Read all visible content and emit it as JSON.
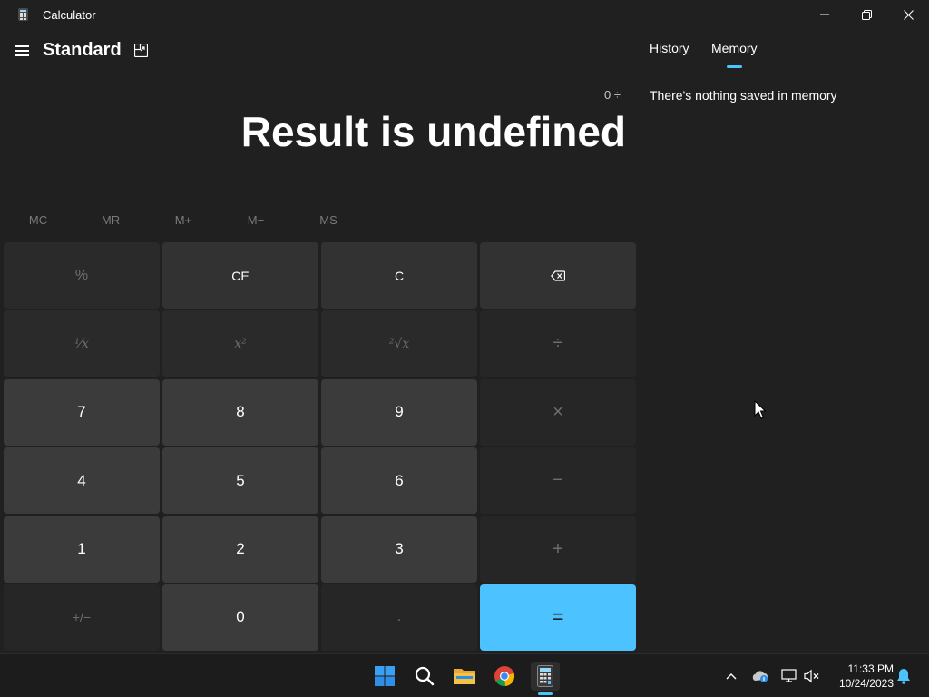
{
  "window": {
    "title": "Calculator",
    "controls": {
      "minimize": "–",
      "maximize": "❐",
      "close": "✕"
    }
  },
  "header": {
    "mode_title": "Standard",
    "menu_icon": "hamburger-icon",
    "keep_on_top_icon": "keep-on-top-icon"
  },
  "display": {
    "expression": "0 ÷",
    "result": "Result is undefined"
  },
  "memory_buttons": [
    "MC",
    "MR",
    "M+",
    "M−",
    "MS"
  ],
  "keypad": {
    "percent": "%",
    "clear_entry": "CE",
    "clear": "C",
    "backspace_icon": "backspace-icon",
    "reciprocal": "¹⁄x",
    "square": "x²",
    "square_root": "²√x",
    "divide": "÷",
    "seven": "7",
    "eight": "8",
    "nine": "9",
    "multiply": "×",
    "four": "4",
    "five": "5",
    "six": "6",
    "subtract": "−",
    "one": "1",
    "two": "2",
    "three": "3",
    "add": "+",
    "negate": "+/−",
    "zero": "0",
    "decimal": ".",
    "equals": "="
  },
  "side_panel": {
    "tabs": [
      "History",
      "Memory"
    ],
    "active_tab": "Memory",
    "empty_message": "There's nothing saved in memory"
  },
  "taskbar": {
    "apps": [
      "start-icon",
      "search-icon",
      "file-explorer-icon",
      "chrome-icon",
      "calculator-icon"
    ],
    "active_app": "calculator-icon",
    "tray": [
      "chevron-up-icon",
      "onedrive-icon",
      "network-icon",
      "volume-muted-icon"
    ],
    "time": "11:33 PM",
    "date": "10/24/2023",
    "notification_icon": "bell-icon"
  },
  "colors": {
    "background": "#202020",
    "accent": "#4cc2ff",
    "number_key": "#3b3b3b",
    "function_key": "#323232"
  }
}
